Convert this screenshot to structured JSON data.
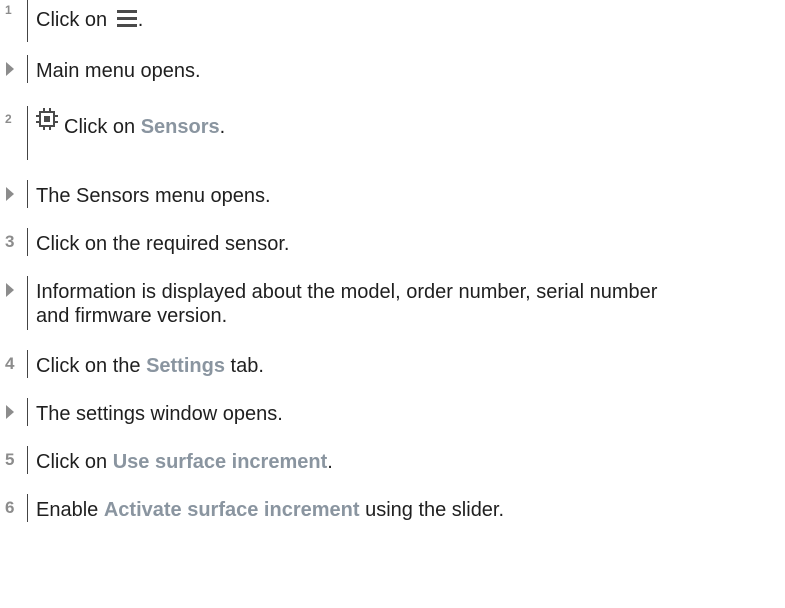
{
  "steps": [
    {
      "marker": "1",
      "text_before": "Click on",
      "text_after": "."
    },
    {
      "result": "Main menu opens."
    },
    {
      "marker": "2",
      "text_before": "Click on ",
      "bold": "Sensors",
      "text_after": "."
    },
    {
      "result": "The Sensors menu opens."
    },
    {
      "marker": "3",
      "text": "Click on the required sensor."
    },
    {
      "result_line1": "Information is displayed about the model, order number, serial number",
      "result_line2": "and firmware version."
    },
    {
      "marker": "4",
      "text_before": "Click on the ",
      "bold": "Settings",
      "text_after": " tab."
    },
    {
      "result": "The settings window opens."
    },
    {
      "marker": "5",
      "text_before": "Click on ",
      "bold": "Use surface increment",
      "text_after": "."
    },
    {
      "marker": "6",
      "text_before": "Enable ",
      "bold": "Activate surface increment",
      "text_after": " using the slider."
    }
  ],
  "icons": {
    "menu": "hamburger-menu-icon",
    "sensor": "sensor-chip-icon"
  },
  "colors": {
    "highlight": "#8a95a0",
    "marker": "#8c8c8c",
    "icon": "#4a4a4a"
  }
}
